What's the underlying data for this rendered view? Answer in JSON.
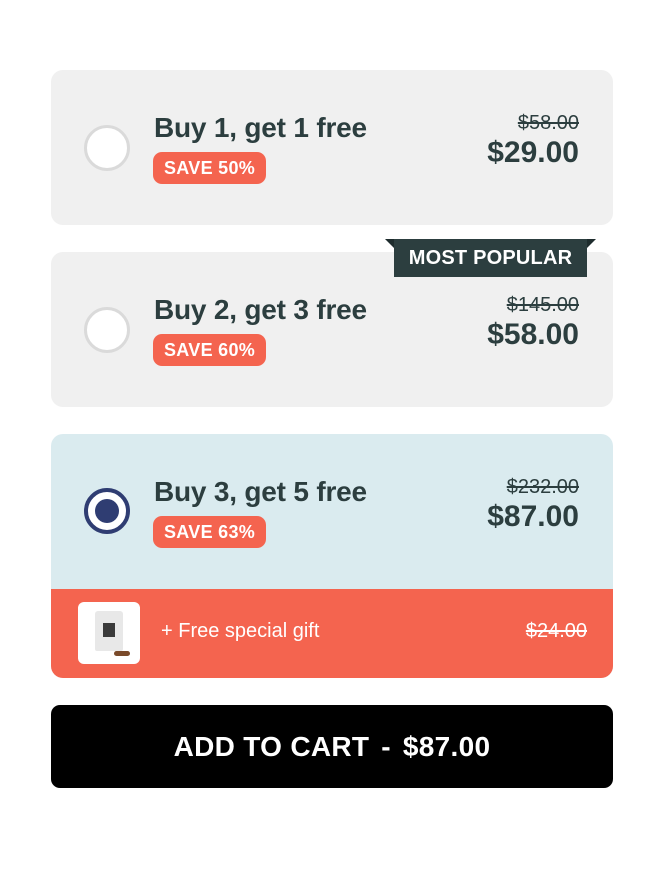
{
  "options": [
    {
      "title": "Buy 1, get 1 free",
      "badge": "SAVE 50%",
      "old_price": "$58.00",
      "new_price": "$29.00",
      "selected": false
    },
    {
      "title": "Buy 2, get 3 free",
      "badge": "SAVE 60%",
      "old_price": "$145.00",
      "new_price": "$58.00",
      "ribbon": "MOST POPULAR",
      "selected": false
    },
    {
      "title": "Buy 3, get 5 free",
      "badge": "SAVE 63%",
      "old_price": "$232.00",
      "new_price": "$87.00",
      "selected": true,
      "gift": {
        "text": "+ Free special gift",
        "old_price": "$24.00",
        "icon": "coffee-bag-icon"
      }
    }
  ],
  "cart_button": {
    "label": "ADD TO CART",
    "separator": "-",
    "price": "$87.00"
  },
  "colors": {
    "accent": "#f4644f",
    "selected_bg": "#daebef",
    "dark": "#2c3e3f",
    "radio_selected": "#2f3d72"
  }
}
